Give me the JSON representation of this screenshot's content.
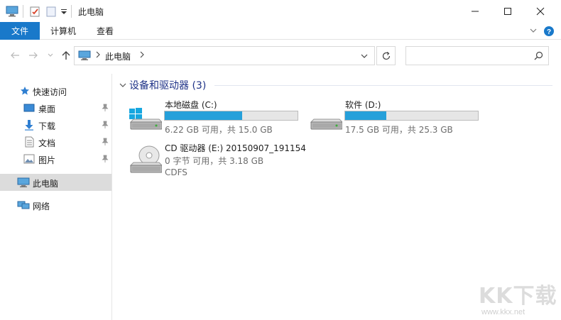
{
  "window": {
    "title": "此电脑"
  },
  "ribbon": {
    "tabs": [
      "文件",
      "计算机",
      "查看"
    ]
  },
  "address": {
    "location": "此电脑",
    "search_placeholder": ""
  },
  "sidebar": {
    "quick_access": "快速访问",
    "items": [
      {
        "label": "桌面",
        "icon": "desktop-icon",
        "pinned": true
      },
      {
        "label": "下载",
        "icon": "download-icon",
        "pinned": true
      },
      {
        "label": "文档",
        "icon": "document-icon",
        "pinned": true
      },
      {
        "label": "图片",
        "icon": "picture-icon",
        "pinned": true
      }
    ],
    "this_pc": "此电脑",
    "network": "网络"
  },
  "content": {
    "group_title": "设备和驱动器 (3)",
    "drives": [
      {
        "name": "本地磁盘 (C:)",
        "free_text": "6.22 GB 可用，共 15.0 GB",
        "used_fraction": 0.585,
        "icon": "windows-drive-icon"
      },
      {
        "name": "软件 (D:)",
        "free_text": "17.5 GB 可用，共 25.3 GB",
        "used_fraction": 0.31,
        "icon": "hard-drive-icon"
      },
      {
        "name": "CD 驱动器 (E:) 20150907_191154",
        "free_text": "0 字节 可用，共 3.18 GB",
        "filesystem": "CDFS",
        "icon": "cd-drive-icon"
      }
    ]
  },
  "watermark": {
    "brand": "KK下载",
    "url": "www.kkx.net"
  },
  "colors": {
    "accent": "#1979ca",
    "progress": "#26a0da",
    "group_header": "#1e3287"
  }
}
